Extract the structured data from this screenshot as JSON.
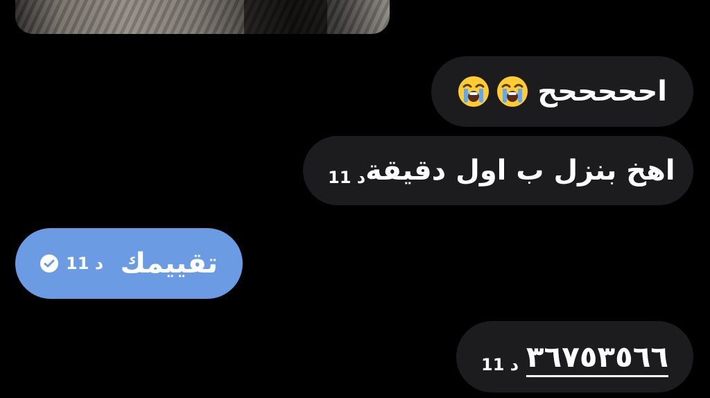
{
  "thread": {
    "image_message": {
      "description": "photo-message"
    },
    "messages": [
      {
        "text": "احححححح",
        "emojis": [
          "loudly-crying-face",
          "loudly-crying-face"
        ],
        "time": ""
      },
      {
        "text": "اهخ بنزل ب اول دقيقة",
        "time": "11 د"
      },
      {
        "text": "تقييمك",
        "time": "11 د",
        "status_icon": "check-circle-icon"
      },
      {
        "text": "٣٦٧٥٣٥٦٦",
        "time": "11 د"
      }
    ]
  },
  "colors": {
    "background": "#000000",
    "incoming_bubble": "#1c1c1e",
    "outgoing_bubble": "#6a9be3",
    "text": "#ffffff"
  }
}
